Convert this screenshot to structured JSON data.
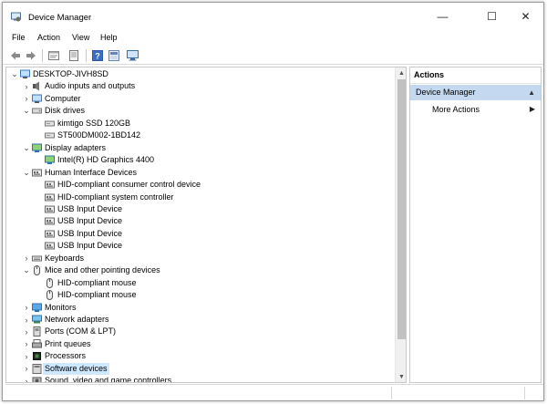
{
  "window": {
    "title": "Device Manager"
  },
  "window_controls": {
    "minimize": "—",
    "maximize": "☐",
    "close": "✕"
  },
  "menubar": {
    "items": [
      "File",
      "Action",
      "View",
      "Help"
    ]
  },
  "toolbar": {
    "buttons": [
      "back-arrow-icon",
      "forward-arrow-icon",
      "properties-icon",
      "update-driver-icon",
      "help-icon",
      "show-hidden-icon",
      "monitor-scan-icon"
    ]
  },
  "tree": {
    "root": "DESKTOP-JIVH8SD",
    "nodes": [
      {
        "label": "Audio inputs and outputs",
        "level": 1,
        "expanded": false,
        "icon": "speaker-icon"
      },
      {
        "label": "Computer",
        "level": 1,
        "expanded": false,
        "icon": "computer-icon"
      },
      {
        "label": "Disk drives",
        "level": 1,
        "expanded": true,
        "icon": "disk-icon"
      },
      {
        "label": "kimtigo SSD 120GB",
        "level": 2,
        "icon": "drive-icon"
      },
      {
        "label": "ST500DM002-1BD142",
        "level": 2,
        "icon": "drive-icon"
      },
      {
        "label": "Display adapters",
        "level": 1,
        "expanded": true,
        "icon": "display-icon"
      },
      {
        "label": "Intel(R) HD Graphics 4400",
        "level": 2,
        "icon": "display-icon"
      },
      {
        "label": "Human Interface Devices",
        "level": 1,
        "expanded": true,
        "icon": "hid-icon"
      },
      {
        "label": "HID-compliant consumer control device",
        "level": 2,
        "icon": "hid-icon"
      },
      {
        "label": "HID-compliant system controller",
        "level": 2,
        "icon": "hid-icon"
      },
      {
        "label": "USB Input Device",
        "level": 2,
        "icon": "hid-icon"
      },
      {
        "label": "USB Input Device",
        "level": 2,
        "icon": "hid-icon"
      },
      {
        "label": "USB Input Device",
        "level": 2,
        "icon": "hid-icon"
      },
      {
        "label": "USB Input Device",
        "level": 2,
        "icon": "hid-icon"
      },
      {
        "label": "Keyboards",
        "level": 1,
        "expanded": false,
        "icon": "keyboard-icon"
      },
      {
        "label": "Mice and other pointing devices",
        "level": 1,
        "expanded": true,
        "icon": "mouse-icon"
      },
      {
        "label": "HID-compliant mouse",
        "level": 2,
        "icon": "mouse-icon"
      },
      {
        "label": "HID-compliant mouse",
        "level": 2,
        "icon": "mouse-icon"
      },
      {
        "label": "Monitors",
        "level": 1,
        "expanded": false,
        "icon": "monitor-icon"
      },
      {
        "label": "Network adapters",
        "level": 1,
        "expanded": false,
        "icon": "network-icon"
      },
      {
        "label": "Ports (COM & LPT)",
        "level": 1,
        "expanded": false,
        "icon": "port-icon"
      },
      {
        "label": "Print queues",
        "level": 1,
        "expanded": false,
        "icon": "printer-icon"
      },
      {
        "label": "Processors",
        "level": 1,
        "expanded": false,
        "icon": "processor-icon"
      },
      {
        "label": "Software devices",
        "level": 1,
        "expanded": false,
        "selected": true,
        "icon": "software-device-icon"
      },
      {
        "label": "Sound, video and game controllers",
        "level": 1,
        "expanded": false,
        "icon": "sound-icon"
      }
    ]
  },
  "actions": {
    "header": "Actions",
    "section": "Device Manager",
    "items": [
      "More Actions"
    ]
  },
  "colors": {
    "selection": "#cde8ff",
    "actions_section_bg": "#c4d9ef",
    "scrollbar_thumb": "#c1c1c1"
  }
}
